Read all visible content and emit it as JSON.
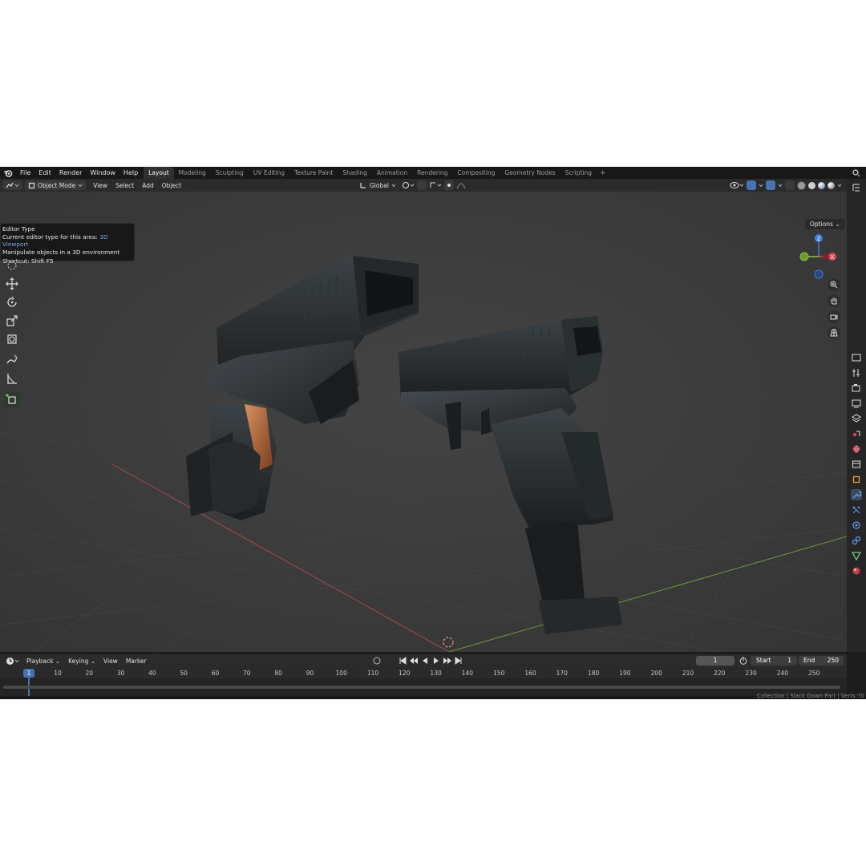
{
  "menu": {
    "items": [
      "File",
      "Edit",
      "Render",
      "Window",
      "Help"
    ]
  },
  "workspaces": {
    "tabs": [
      "Layout",
      "Modeling",
      "Sculpting",
      "UV Editing",
      "Texture Paint",
      "Shading",
      "Animation",
      "Rendering",
      "Compositing",
      "Geometry Nodes",
      "Scripting"
    ],
    "active": "Layout",
    "add_label": "+"
  },
  "viewport_header": {
    "mode_label": "Object Mode",
    "menus": [
      "View",
      "Select",
      "Add",
      "Object"
    ],
    "orientation_label": "Global"
  },
  "tooltip": {
    "title": "Editor Type",
    "line1_prefix": "Current editor type for this area:",
    "line1_value": "3D Viewport",
    "line2": "Manipulate objects in a 3D environment",
    "shortcut": "Shortcut: Shift F5"
  },
  "viewport": {
    "options_label": "Options",
    "gizmo": {
      "z": "Z",
      "x": "X"
    }
  },
  "timeline": {
    "menus": [
      "Playback",
      "Keying",
      "View",
      "Marker"
    ],
    "current_frame": "1",
    "start_label": "Start",
    "start_value": "1",
    "end_label": "End",
    "end_value": "250",
    "ticks": [
      "10",
      "20",
      "30",
      "40",
      "50",
      "60",
      "70",
      "80",
      "90",
      "100",
      "110",
      "120",
      "130",
      "140",
      "150",
      "160",
      "170",
      "180",
      "190",
      "200",
      "210",
      "220",
      "230",
      "240",
      "250"
    ]
  },
  "status": {
    "text": "Collection | Slack Down Part | Verts:70"
  },
  "colors": {
    "accent": "#4772b3",
    "axis_x": "#e0485a",
    "axis_y": "#8bc34a",
    "axis_z": "#3f7fd9"
  }
}
